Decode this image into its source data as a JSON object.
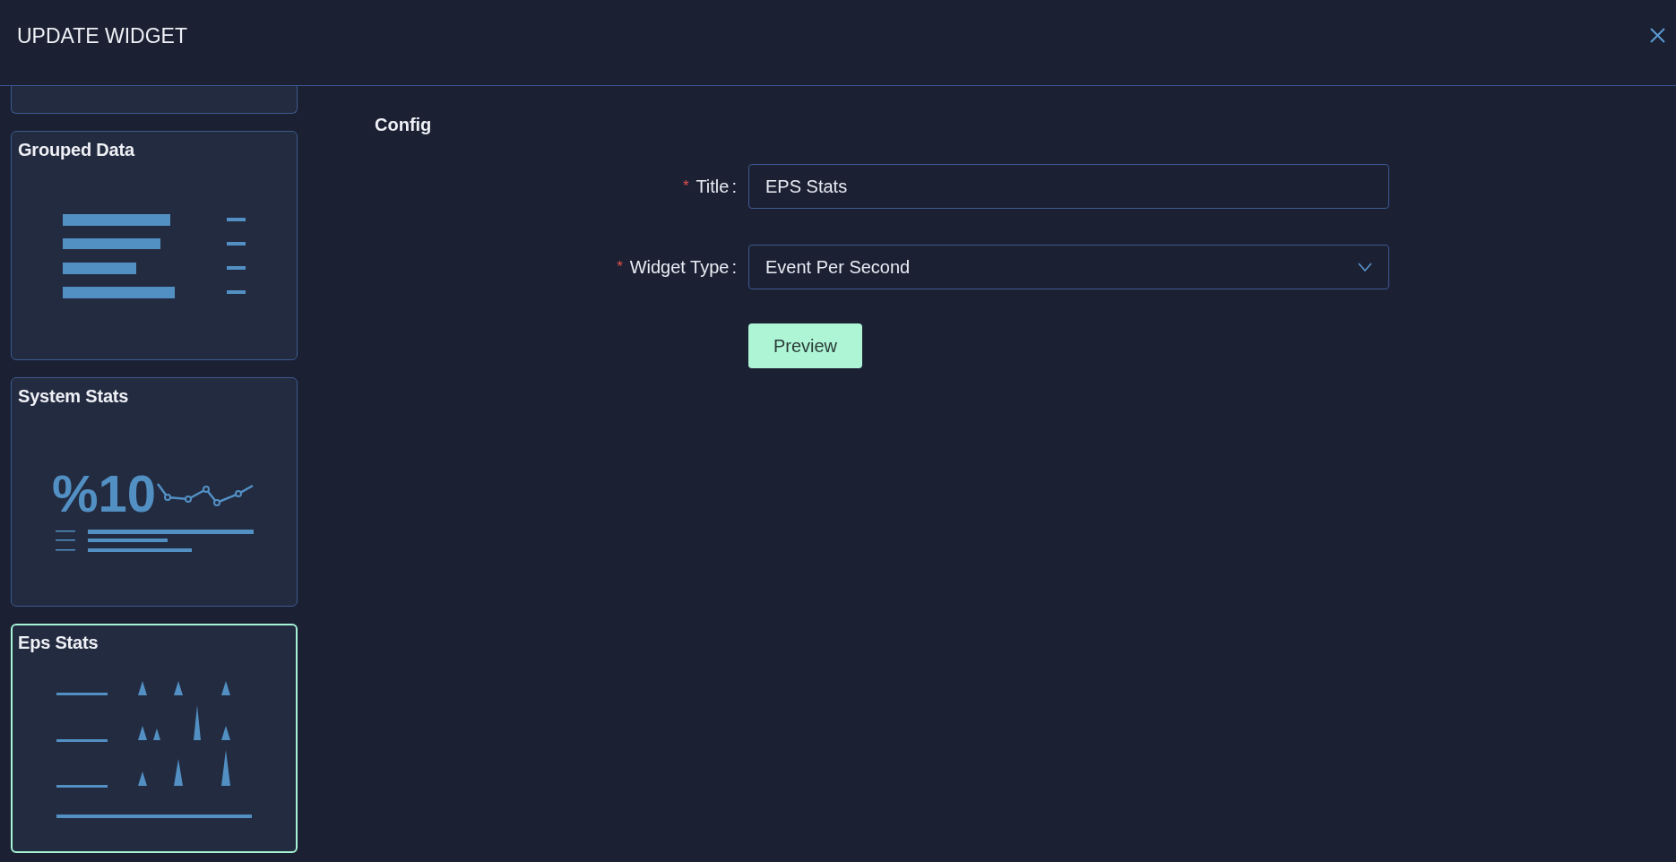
{
  "dialog": {
    "title": "UPDATE WIDGET"
  },
  "widgets": [
    {
      "kind": "clipped",
      "selected": false
    },
    {
      "kind": "grouped",
      "title": "Grouped Data",
      "selected": false
    },
    {
      "kind": "system",
      "title": "System Stats",
      "selected": false,
      "figure": "%10"
    },
    {
      "kind": "eps",
      "title": "Eps Stats",
      "selected": true
    }
  ],
  "config": {
    "heading": "Config",
    "fields": [
      {
        "kind": "input",
        "required": true,
        "required_mark": "*",
        "label": "Title",
        "separator": ":",
        "value": "EPS Stats"
      },
      {
        "kind": "select",
        "required": true,
        "required_mark": "*",
        "label": "Widget Type",
        "separator": ":",
        "value": "Event Per Second"
      }
    ],
    "button": "Preview"
  }
}
